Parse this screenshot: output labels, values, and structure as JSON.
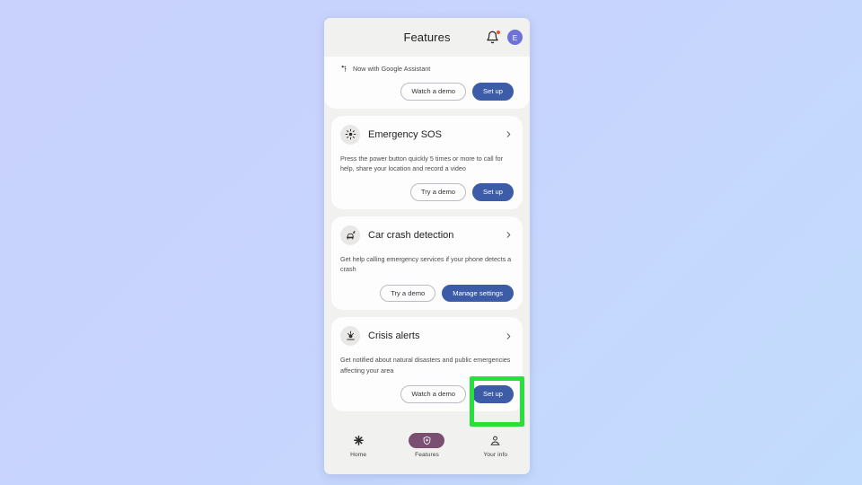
{
  "background": {
    "from": "#c9d2fd",
    "to": "#c2dcfd"
  },
  "header": {
    "title": "Features",
    "notifications_icon": "bell-icon",
    "notification_badge_color": "#e8512f",
    "avatar_initial": "E",
    "avatar_color": "#6d72d6"
  },
  "promo": {
    "icon": "assistant-sparkle-icon",
    "text": "Now with Google Assistant",
    "buttons": [
      {
        "label": "Watch a demo",
        "style": "outline"
      },
      {
        "label": "Set up",
        "style": "filled"
      }
    ]
  },
  "cards": [
    {
      "icon": "emergency-sos-icon",
      "title": "Emergency SOS",
      "description": "Press the power button quickly 5 times or more to call for help, share your location and record a video",
      "chevron": "chevron-right-icon",
      "buttons": [
        {
          "label": "Try a demo",
          "style": "outline"
        },
        {
          "label": "Set up",
          "style": "filled"
        }
      ]
    },
    {
      "icon": "car-crash-icon",
      "title": "Car crash detection",
      "description": "Get help calling emergency services if your phone detects a crash",
      "chevron": "chevron-right-icon",
      "buttons": [
        {
          "label": "Try a demo",
          "style": "outline"
        },
        {
          "label": "Manage settings",
          "style": "filled"
        }
      ]
    },
    {
      "icon": "crisis-alert-icon",
      "title": "Crisis alerts",
      "description": "Get notified about natural disasters and public emergencies affecting your area",
      "chevron": "chevron-right-icon",
      "buttons": [
        {
          "label": "Watch a demo",
          "style": "outline"
        },
        {
          "label": "Set up",
          "style": "filled"
        }
      ]
    }
  ],
  "bottom_nav": {
    "items": [
      {
        "label": "Home",
        "icon": "asterisk-icon",
        "active": false
      },
      {
        "label": "Features",
        "icon": "shield-icon",
        "active": true
      },
      {
        "label": "Your info",
        "icon": "person-icon",
        "active": false
      }
    ],
    "active_pill_color": "#7a4f72"
  },
  "highlight": {
    "color": "#28e03c",
    "target_label": "Set up"
  },
  "colors": {
    "accent_button": "#3c5ca8",
    "card_bg": "#fdfdfd",
    "screen_bg": "#f1f1ef"
  }
}
